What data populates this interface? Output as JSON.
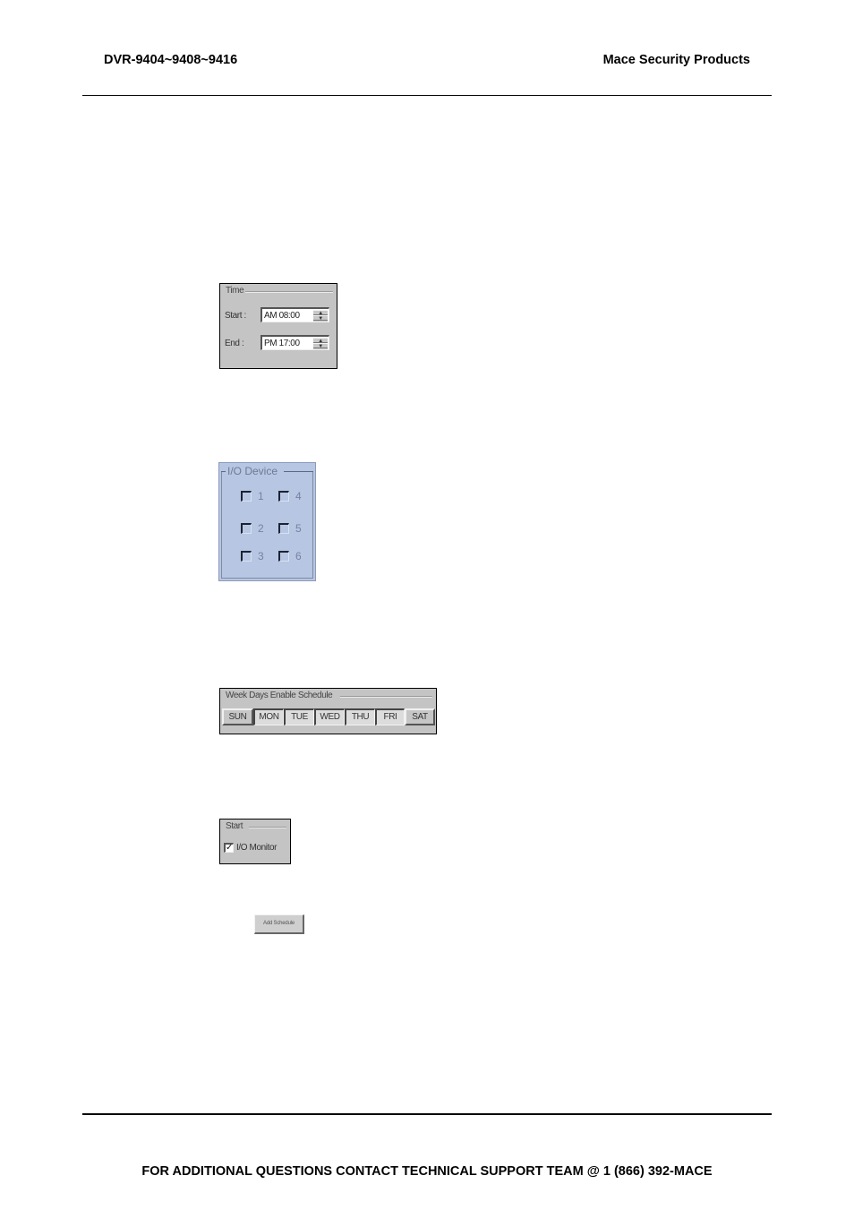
{
  "header": {
    "left": "DVR-9404~9408~9416",
    "right": "Mace Security Products"
  },
  "time_panel": {
    "title": "Time",
    "start_label": "Start :",
    "start_value": "AM 08:00",
    "end_label": "End :",
    "end_value": "PM 17:00",
    "spin_up": "▲",
    "spin_down": "▼"
  },
  "io_panel": {
    "title": "I/O Device",
    "background": "#b7c6e2",
    "items": [
      {
        "label": "1",
        "checked": false
      },
      {
        "label": "2",
        "checked": false
      },
      {
        "label": "3",
        "checked": false
      },
      {
        "label": "4",
        "checked": false
      },
      {
        "label": "5",
        "checked": false
      },
      {
        "label": "6",
        "checked": false
      }
    ]
  },
  "week_panel": {
    "title": "Week Days Enable Schedule",
    "days": [
      {
        "label": "SUN",
        "pressed": false
      },
      {
        "label": "MON",
        "pressed": true
      },
      {
        "label": "TUE",
        "pressed": true
      },
      {
        "label": "WED",
        "pressed": true
      },
      {
        "label": "THU",
        "pressed": true
      },
      {
        "label": "FRI",
        "pressed": true
      },
      {
        "label": "SAT",
        "pressed": false
      }
    ]
  },
  "start_panel": {
    "title": "Start",
    "checkbox_label": "I/O Monitor",
    "checked": true,
    "check_glyph": "✓"
  },
  "add_schedule_button": "Add Schedule",
  "footer": "FOR ADDITIONAL QUESTIONS CONTACT TECHNICAL SUPPORT TEAM @ 1 (866) 392-MACE"
}
